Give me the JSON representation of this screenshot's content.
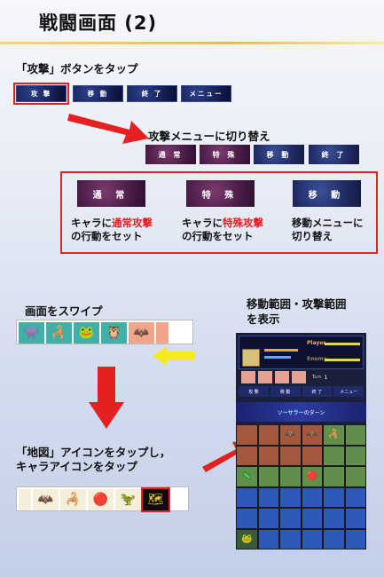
{
  "page": {
    "title": "戦闘画面 (2)"
  },
  "step1": {
    "label": "「攻撃」ボタンをタップ",
    "buttons": [
      "攻 撃",
      "移 動",
      "終 了",
      "メニュー"
    ]
  },
  "step2": {
    "label": "攻撃メニューに切り替え",
    "buttons": [
      "通 常",
      "特 殊",
      "移 動",
      "終 了"
    ]
  },
  "explain": {
    "items": [
      {
        "button": "通 常",
        "line1_a": "キャラに",
        "line1_red": "通常攻撃",
        "line2": "の行動をセット"
      },
      {
        "button": "特 殊",
        "line1_a": "キャラに",
        "line1_red": "特殊攻撃",
        "line2": "の行動をセット"
      },
      {
        "button": "移 動",
        "line1_a": "移動メニューに",
        "line1_red": "",
        "line2": "切り替え"
      }
    ]
  },
  "swipe": {
    "label": "画面をスワイプ"
  },
  "range": {
    "label_line1": "移動範囲・攻撃範囲",
    "label_line2": "を表示"
  },
  "map_step": {
    "label_line1": "「地図」アイコンをタップし，",
    "label_line2": "キャラアイコンをタップ"
  },
  "phone": {
    "player_label": "Player",
    "enemy_label": "Enemy",
    "turn_label": "Turn",
    "turn_value": "1",
    "buttons": [
      "攻 撃",
      "移 動",
      "終 了",
      "メニュー"
    ],
    "banner_name": "ソーサラー",
    "banner_suffix": "のターン"
  },
  "colors": {
    "accent_red": "#e52020",
    "arrow_yellow": "#f5ea1c",
    "title_rule": "#e8c520"
  }
}
